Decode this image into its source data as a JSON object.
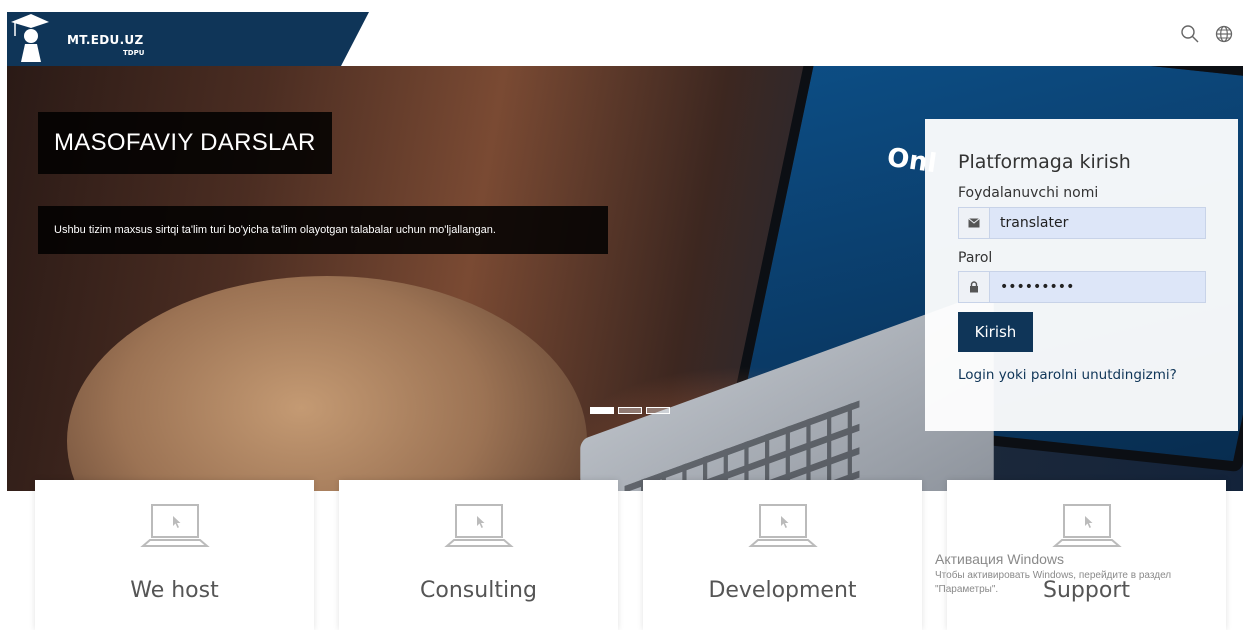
{
  "header": {
    "brand_title": "MT.EDU.UZ",
    "brand_subtitle": "TDPU",
    "search_icon": "search-icon",
    "language_icon": "globe-icon"
  },
  "hero": {
    "title": "MASOFAVIY DARSLAR",
    "subtitle": "Ushbu tizim maxsus sirtqi ta'lim turi bo'yicha ta'lim olayotgan talabalar uchun mo'ljallangan.",
    "screen_text": "Onl",
    "slides": [
      {
        "active": true
      },
      {
        "active": false
      },
      {
        "active": false
      }
    ]
  },
  "login": {
    "heading": "Platformaga kirish",
    "username_label": "Foydalanuvchi nomi",
    "username_value": "translater",
    "password_label": "Parol",
    "password_value": "•••••••••",
    "submit_label": "Kirish",
    "forgot_link": "Login yoki parolni unutdingizmi?"
  },
  "cards": [
    {
      "title": "We host",
      "icon": "laptop-icon"
    },
    {
      "title": "Consulting",
      "icon": "laptop-icon"
    },
    {
      "title": "Development",
      "icon": "laptop-icon"
    },
    {
      "title": "Support",
      "icon": "laptop-icon"
    }
  ],
  "watermark": {
    "line1": "Активация Windows",
    "line2": "Чтобы активировать Windows, перейдите в раздел \"Параметры\"."
  },
  "colors": {
    "brand": "#0f3558",
    "field_bg": "#dde6f8"
  }
}
